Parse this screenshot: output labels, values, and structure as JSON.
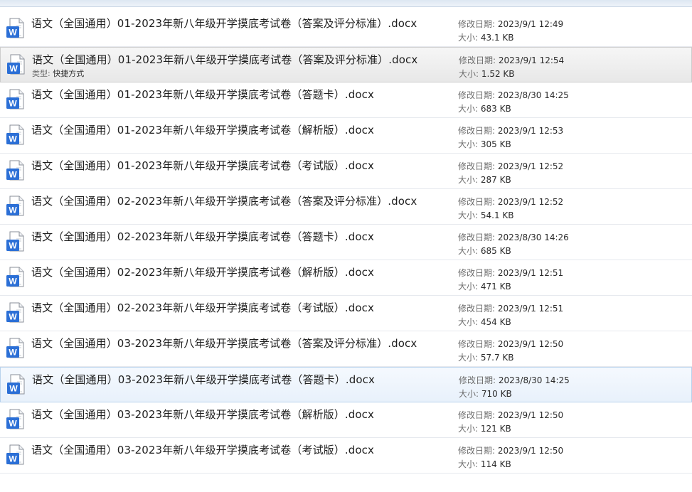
{
  "labels": {
    "modified": "修改日期:",
    "size": "大小:",
    "type": "类型:"
  },
  "icon": {
    "name": "word-document-icon",
    "letter": "W",
    "color": "#2b6fd6"
  },
  "files": [
    {
      "name": "语文（全国通用）01-2023年新八年级开学摸底考试卷（答案及评分标准）.docx",
      "modified": "2023/9/1 12:49",
      "size": "43.1 KB",
      "state": "normal"
    },
    {
      "name": "语文（全国通用）01-2023年新八年级开学摸底考试卷（答案及评分标准）.docx",
      "type": "快捷方式",
      "modified": "2023/9/1 12:54",
      "size": "1.52 KB",
      "state": "selected"
    },
    {
      "name": "语文（全国通用）01-2023年新八年级开学摸底考试卷（答题卡）.docx",
      "modified": "2023/8/30 14:25",
      "size": "683 KB",
      "state": "normal"
    },
    {
      "name": "语文（全国通用）01-2023年新八年级开学摸底考试卷（解析版）.docx",
      "modified": "2023/9/1 12:53",
      "size": "305 KB",
      "state": "normal"
    },
    {
      "name": "语文（全国通用）01-2023年新八年级开学摸底考试卷（考试版）.docx",
      "modified": "2023/9/1 12:52",
      "size": "287 KB",
      "state": "normal"
    },
    {
      "name": "语文（全国通用）02-2023年新八年级开学摸底考试卷（答案及评分标准）.docx",
      "modified": "2023/9/1 12:52",
      "size": "54.1 KB",
      "state": "normal"
    },
    {
      "name": "语文（全国通用）02-2023年新八年级开学摸底考试卷（答题卡）.docx",
      "modified": "2023/8/30 14:26",
      "size": "685 KB",
      "state": "normal"
    },
    {
      "name": "语文（全国通用）02-2023年新八年级开学摸底考试卷（解析版）.docx",
      "modified": "2023/9/1 12:51",
      "size": "471 KB",
      "state": "normal"
    },
    {
      "name": "语文（全国通用）02-2023年新八年级开学摸底考试卷（考试版）.docx",
      "modified": "2023/9/1 12:51",
      "size": "454 KB",
      "state": "normal"
    },
    {
      "name": "语文（全国通用）03-2023年新八年级开学摸底考试卷（答案及评分标准）.docx",
      "modified": "2023/9/1 12:50",
      "size": "57.7 KB",
      "state": "normal"
    },
    {
      "name": "语文（全国通用）03-2023年新八年级开学摸底考试卷（答题卡）.docx",
      "modified": "2023/8/30 14:25",
      "size": "710 KB",
      "state": "hover"
    },
    {
      "name": "语文（全国通用）03-2023年新八年级开学摸底考试卷（解析版）.docx",
      "modified": "2023/9/1 12:50",
      "size": "121 KB",
      "state": "normal"
    },
    {
      "name": "语文（全国通用）03-2023年新八年级开学摸底考试卷（考试版）.docx",
      "modified": "2023/9/1 12:50",
      "size": "114 KB",
      "state": "normal"
    }
  ]
}
